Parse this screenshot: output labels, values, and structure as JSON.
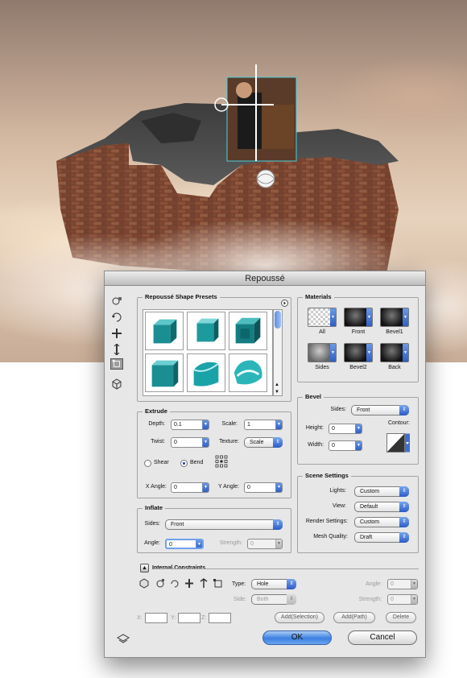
{
  "dialog": {
    "title": "Repoussé",
    "ok_label": "OK",
    "cancel_label": "Cancel"
  },
  "presets": {
    "title": "Repoussé Shape Presets",
    "menu_icon": "circle-arrow-icon",
    "shapes": [
      "cube",
      "bevel-cube",
      "box-frame",
      "tall-box",
      "twisted",
      "wave"
    ],
    "color": "#1a8f93"
  },
  "materials": {
    "title": "Materials",
    "items": [
      {
        "label": "All"
      },
      {
        "label": "Front"
      },
      {
        "label": "Bevel1"
      },
      {
        "label": "Sides"
      },
      {
        "label": "Bevel2"
      },
      {
        "label": "Back"
      }
    ]
  },
  "extrude": {
    "title": "Extrude",
    "depth_label": "Depth:",
    "depth_value": "0.1",
    "scale_label": "Scale:",
    "scale_value": "1",
    "twist_label": "Twist:",
    "twist_value": "0",
    "texture_label": "Texture:",
    "texture_value": "Scale",
    "shear_label": "Shear",
    "bend_label": "Bend",
    "bend_selected": true,
    "xangle_label": "X Angle:",
    "xangle_value": "0",
    "yangle_label": "Y Angle:",
    "yangle_value": "0"
  },
  "bevel": {
    "title": "Bevel",
    "sides_label": "Sides:",
    "sides_value": "Front",
    "height_label": "Height:",
    "height_value": "0",
    "width_label": "Width:",
    "width_value": "0",
    "contour_label": "Contour:"
  },
  "inflate": {
    "title": "Inflate",
    "sides_label": "Sides:",
    "sides_value": "Front",
    "angle_label": "Angle:",
    "angle_value": "0",
    "strength_label": "Strength:",
    "strength_value": "0"
  },
  "scene": {
    "title": "Scene Settings",
    "lights_label": "Lights:",
    "lights_value": "Custom",
    "view_label": "View:",
    "view_value": "Default",
    "render_label": "Render Settings:",
    "render_value": "Custom",
    "mesh_label": "Mesh Quality:",
    "mesh_value": "Draft"
  },
  "constraints": {
    "title": "Internal Constraints",
    "type_label": "Type:",
    "type_value": "Hole",
    "side_label": "Side:",
    "side_value": "Both",
    "angle_label": "Angle:",
    "angle_value": "0",
    "strength_label": "Strength:",
    "strength_value": "0",
    "x_label": "X:",
    "y_label": "Y:",
    "z_label": "Z:",
    "add_selection": "Add(Selection)",
    "add_path": "Add(Path)",
    "delete": "Delete"
  }
}
